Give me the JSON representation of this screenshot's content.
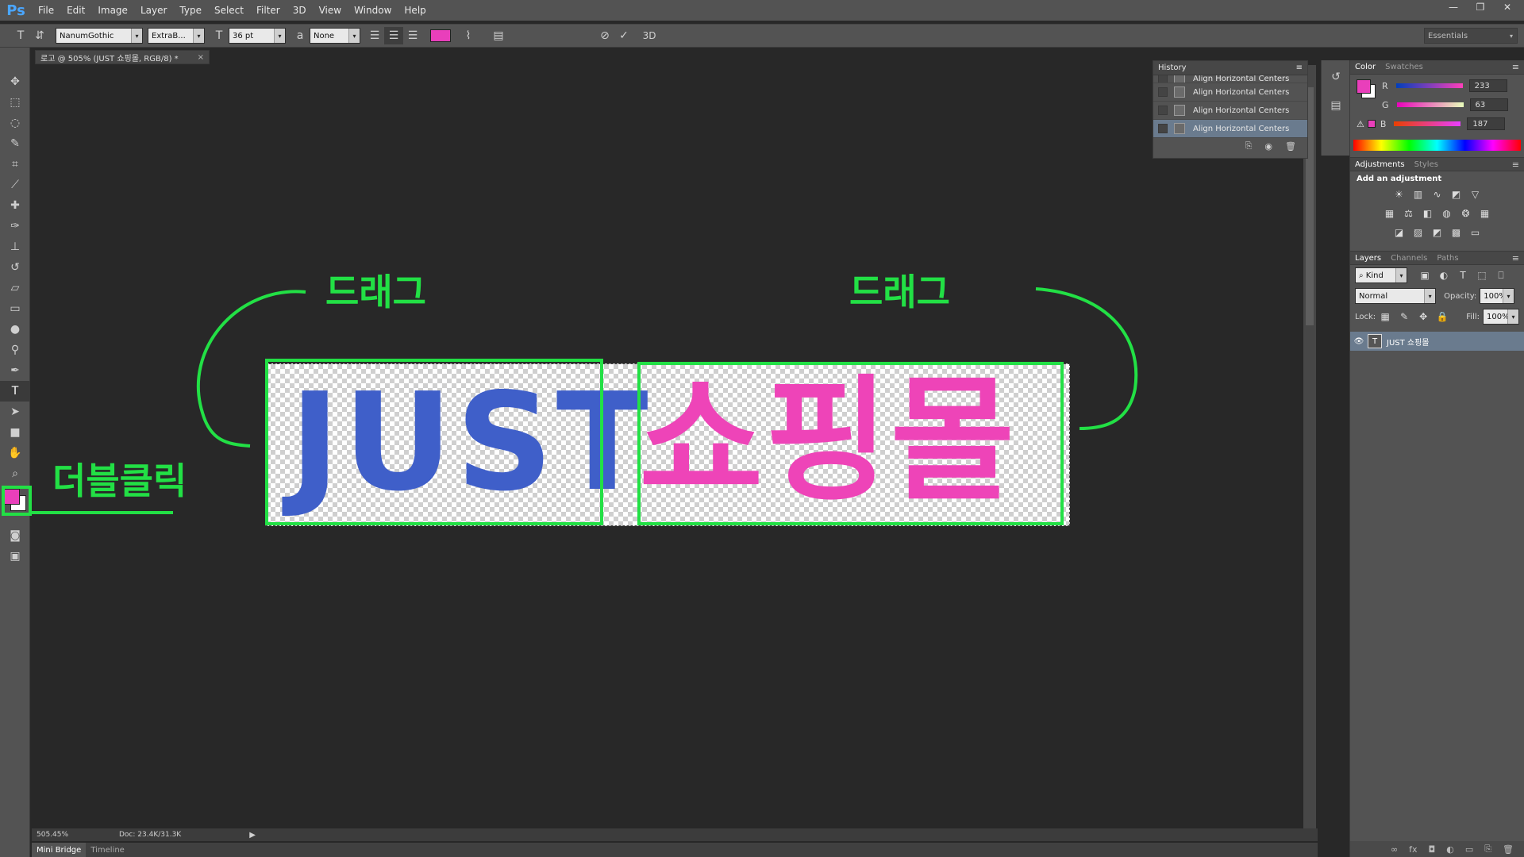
{
  "app": {
    "logo": "Ps",
    "menu": [
      "File",
      "Edit",
      "Image",
      "Layer",
      "Type",
      "Select",
      "Filter",
      "3D",
      "View",
      "Window",
      "Help"
    ],
    "window_controls": [
      "—",
      "❐",
      "✕"
    ]
  },
  "options_bar": {
    "font_family": "NanumGothic",
    "font_style": "ExtraB...",
    "font_size": "36 pt",
    "antialias": "None",
    "text_color": "#e93fbb",
    "commit_label": "3D",
    "workspace": "Essentials"
  },
  "document": {
    "tab_title": "로고 @ 505% (JUST 쇼핑몰, RGB/8) *",
    "close": "×",
    "zoom": "505.45%",
    "doc_size": "Doc: 23.4K/31.3K",
    "bottom_tabs": [
      "Mini Bridge",
      "Timeline"
    ]
  },
  "artwork": {
    "text_blue": "JUST",
    "text_pink": "쇼핑몰",
    "blue_color": "#3f5fc9",
    "pink_color": "#ee44b8"
  },
  "annotations": {
    "drag_left": "드래그",
    "drag_right": "드래그",
    "double_click": "더블클릭",
    "color": "#22e045"
  },
  "history": {
    "title": "History",
    "rows": [
      "Align Horizontal Centers",
      "Align Horizontal Centers",
      "Align Horizontal Centers",
      "Align Horizontal Centers"
    ]
  },
  "color_panel": {
    "tabs": [
      "Color",
      "Swatches"
    ],
    "r_label": "R",
    "g_label": "G",
    "b_label": "B",
    "r": "233",
    "g": "63",
    "b": "187",
    "fg": "#e93fbb"
  },
  "adjustments": {
    "tabs": [
      "Adjustments",
      "Styles"
    ],
    "add_label": "Add an adjustment"
  },
  "layers": {
    "tabs": [
      "Layers",
      "Channels",
      "Paths"
    ],
    "kind": "Kind",
    "blend": "Normal",
    "opacity_label": "Opacity:",
    "opacity": "100%",
    "lock_label": "Lock:",
    "fill_label": "Fill:",
    "fill": "100%",
    "layer_name": "JUST 쇼핑몰"
  }
}
